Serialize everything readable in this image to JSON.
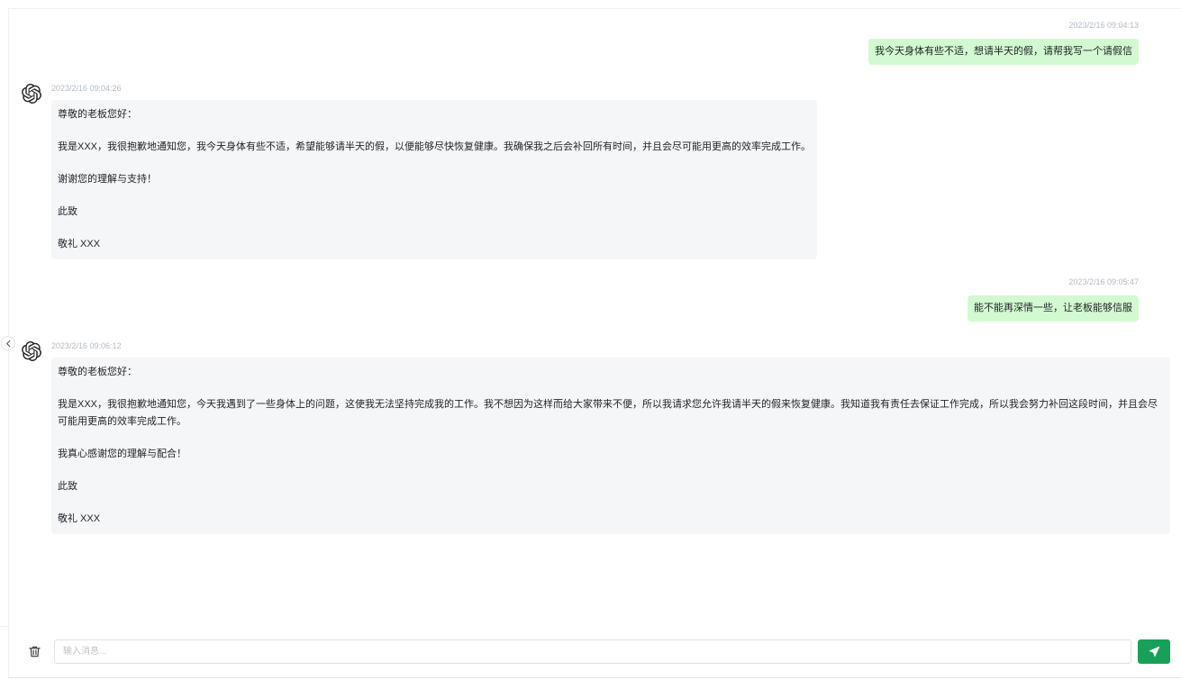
{
  "sidebar": {
    "collapse_icon": "chevron-left-icon"
  },
  "messages": [
    {
      "role": "user",
      "time": "2023/2/16 09:04:13",
      "text": "我今天身体有些不适，想请半天的假，请帮我写一个请假信"
    },
    {
      "role": "assistant",
      "avatar_icon": "openai-logo-icon",
      "time": "2023/2/16 09:04:26",
      "paragraphs": [
        "尊敬的老板您好：",
        "我是XXX，我很抱歉地通知您，我今天身体有些不适，希望能够请半天的假，以便能够尽快恢复健康。我确保我之后会补回所有时间，并且会尽可能用更高的效率完成工作。",
        "谢谢您的理解与支持！",
        "此致",
        "敬礼 XXX"
      ]
    },
    {
      "role": "user",
      "time": "2023/2/16 09:05:47",
      "text": "能不能再深情一些，让老板能够信服"
    },
    {
      "role": "assistant",
      "avatar_icon": "openai-logo-icon",
      "time": "2023/2/16 09:06:12",
      "paragraphs": [
        "尊敬的老板您好：",
        "我是XXX，我很抱歉地通知您，今天我遇到了一些身体上的问题，这使我无法坚持完成我的工作。我不想因为这样而给大家带来不便，所以我请求您允许我请半天的假来恢复健康。我知道我有责任去保证工作完成，所以我会努力补回这段时间，并且会尽可能用更高的效率完成工作。",
        "我真心感谢您的理解与配合！",
        "此致",
        "敬礼 XXX"
      ]
    }
  ],
  "footer": {
    "clear_icon": "trash-icon",
    "input_placeholder": "输入消息...",
    "input_value": "",
    "send_icon": "send-icon"
  },
  "colors": {
    "user_bubble": "#d2f9d1",
    "assistant_bubble": "#f4f6f8",
    "accent": "#18a058",
    "timestamp": "#b4bbc4"
  }
}
